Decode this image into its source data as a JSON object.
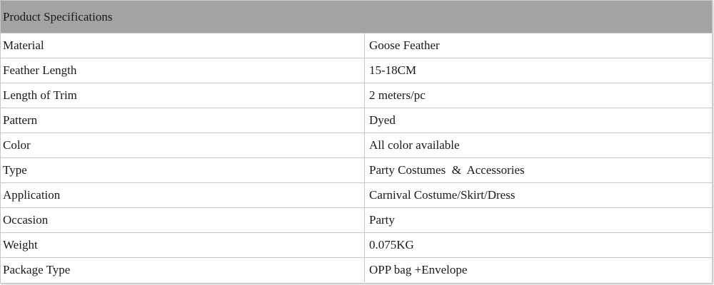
{
  "header": {
    "title": "Product Specifications"
  },
  "specs": [
    {
      "label": "Material",
      "value": "Goose Feather"
    },
    {
      "label": "Feather Length",
      "value": "15-18CM"
    },
    {
      "label": "Length of Trim",
      "value": "2 meters/pc"
    },
    {
      "label": "Pattern",
      "value": "Dyed"
    },
    {
      "label": "Color",
      "value": "All color available"
    },
    {
      "label": "Type",
      "value": "Party Costumes  &  Accessories"
    },
    {
      "label": "Application",
      "value": "Carnival Costume/Skirt/Dress"
    },
    {
      "label": "Occasion",
      "value": "Party"
    },
    {
      "label": "Weight",
      "value": "0.075KG"
    },
    {
      "label": "Package Type",
      "value": "OPP bag +Envelope"
    }
  ],
  "colors": {
    "header_bg": "#a3a3a3",
    "border": "#c8c8c8",
    "text": "#1a1a1a"
  }
}
